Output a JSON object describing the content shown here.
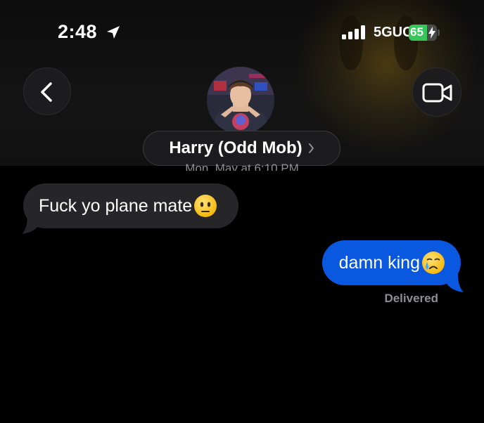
{
  "status_bar": {
    "time": "2:48",
    "network": "5GUC",
    "battery_percent": "65",
    "battery_level": 0.65,
    "signal_bars": 4,
    "icons": [
      "location-arrow-icon",
      "cellular-signal-icon",
      "battery-icon",
      "charging-bolt-icon"
    ]
  },
  "header": {
    "contact_name": "Harry  (Odd Mob)",
    "chevron": "›",
    "timestamp": "Mon, May at 6:10 PM",
    "back_icon": "chevron-left-icon",
    "video_icon": "video-camera-icon",
    "avatar": "contact-avatar-photo"
  },
  "messages": [
    {
      "direction": "incoming",
      "text": "Fuck yo plane mate",
      "emoji": "neutral-face-emoji",
      "bubble_color": "#262629"
    },
    {
      "direction": "outgoing",
      "text": "damn king",
      "emoji": "crying-face-emoji",
      "bubble_color": "#0a58e0"
    }
  ],
  "delivery_status": "Delivered"
}
